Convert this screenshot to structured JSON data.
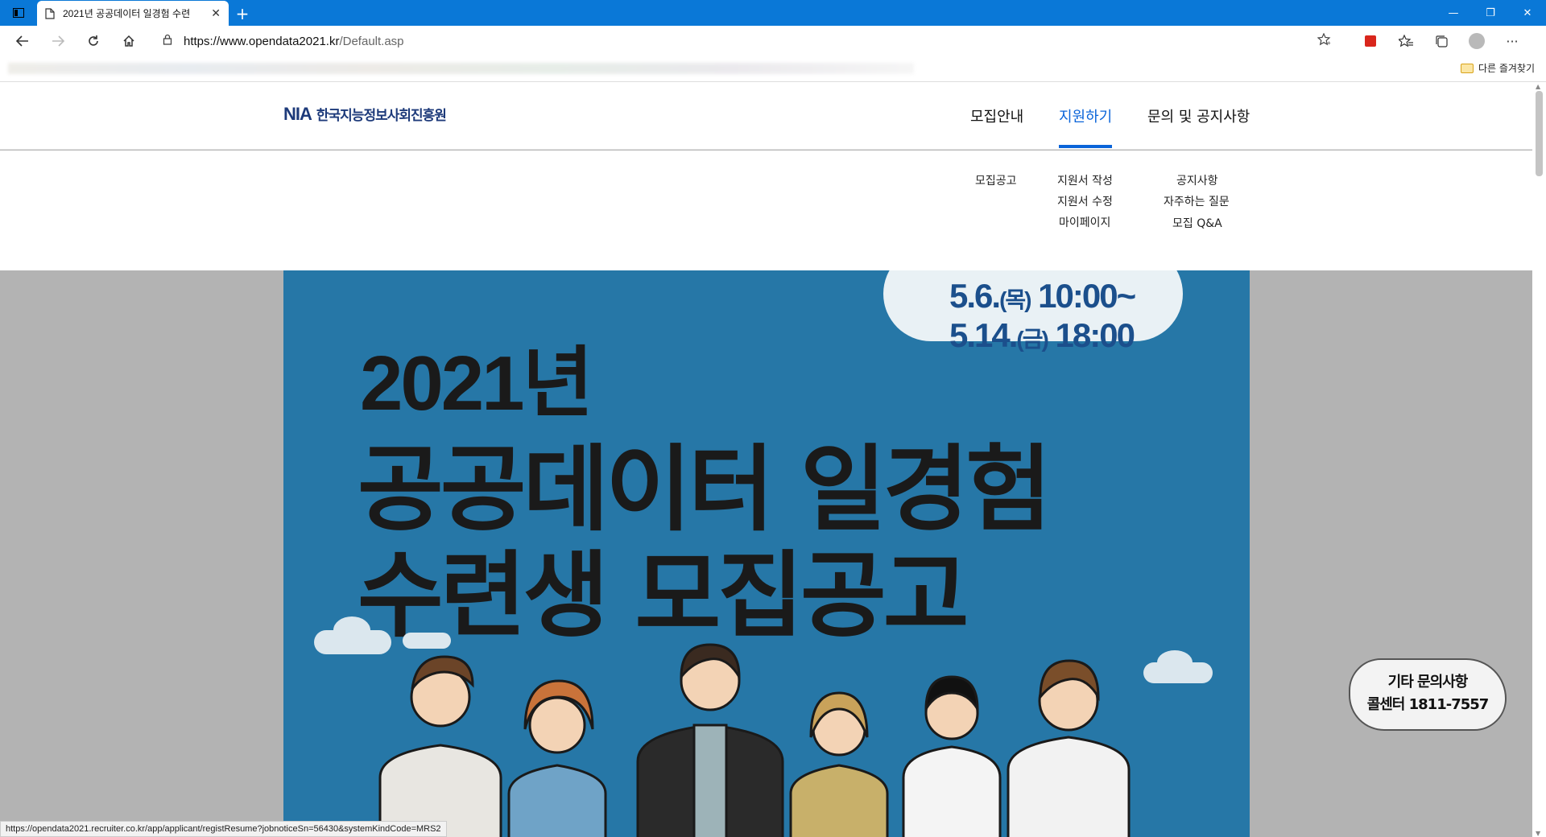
{
  "browser": {
    "tab_title": "2021년 공공데이터 일경험 수련",
    "url_host": "https://www.opendata2021.kr",
    "url_path": "/Default.asp",
    "other_favorites": "다른 즐겨찾기",
    "status_url": "https://opendata2021.recruiter.co.kr/app/applicant/registResume?jobnoticeSn=56430&systemKindCode=MRS2"
  },
  "header": {
    "logo_mark": "NIA",
    "logo_text": "한국지능정보사회진흥원",
    "nav": [
      "모집안내",
      "지원하기",
      "문의 및 공지사항"
    ],
    "active_nav": "지원하기"
  },
  "submenu": {
    "col1": [
      "모집공고"
    ],
    "col2": [
      "지원서 작성",
      "지원서 수정",
      "마이페이지"
    ],
    "col3": [
      "공지사항",
      "자주하는 질문",
      "모집 Q&A"
    ]
  },
  "poster": {
    "date_line1_main": "5.6.",
    "date_line1_day": "(목)",
    "date_line1_time": "10:00~",
    "date_line2_main": "5.14.",
    "date_line2_day": "(금)",
    "date_line2_time": "18:00",
    "year": "2021년",
    "title_line1": "공공데이터 일경험",
    "title_line2": "수련생 모집공고"
  },
  "contact": {
    "line1": "기타 문의사항",
    "line2": "콜센터 1811-7557"
  },
  "colors": {
    "edge_blue": "#0a78d7",
    "nav_active": "#0a64d9",
    "poster_bg": "#2677a7",
    "logo": "#1d3a7a"
  }
}
